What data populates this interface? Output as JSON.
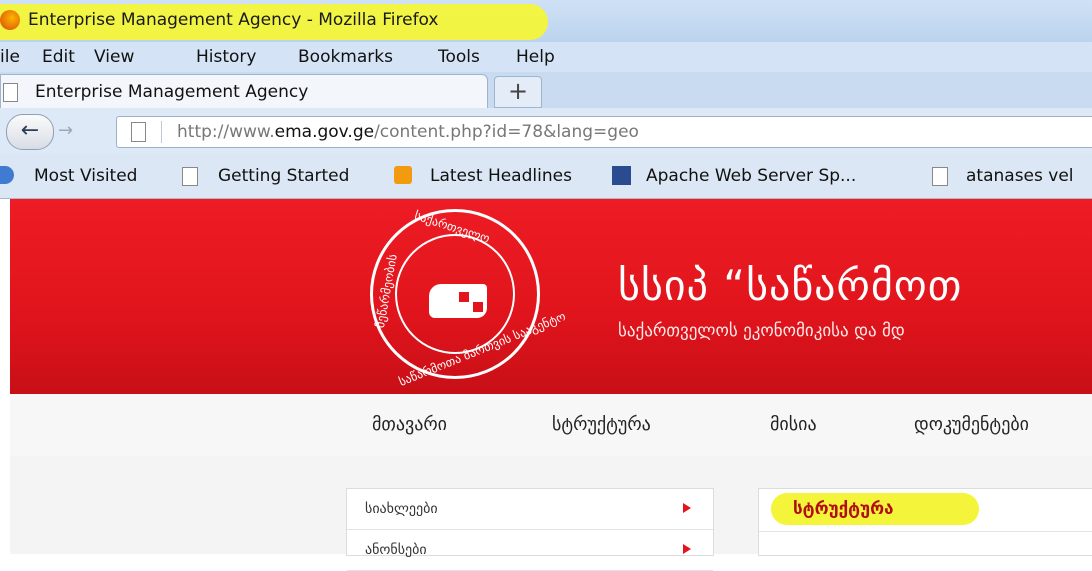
{
  "window": {
    "title": "Enterprise Management Agency - Mozilla Firefox"
  },
  "menu": {
    "file": "ile",
    "edit": "Edit",
    "view": "View",
    "history": "History",
    "bookmarks": "Bookmarks",
    "tools": "Tools",
    "help": "Help"
  },
  "tab": {
    "label": "Enterprise Management Agency",
    "new_tab": "+"
  },
  "nav": {
    "back": "←",
    "forward": "→",
    "url_prefix": "http://www.",
    "url_host": "ema.gov.ge",
    "url_path": "/content.php?id=78&lang=geo"
  },
  "bookmarks": {
    "most_visited": "Most Visited",
    "getting_started": "Getting Started",
    "latest_headlines": "Latest Headlines",
    "apache": "Apache Web Server Sp...",
    "atanases": "atanases vel"
  },
  "site": {
    "seal_top": "საქართველო",
    "seal_left": "მეწარმეობის",
    "seal_bottom": "საწარმოთა მართვის სააგენტო",
    "title": "სსიპ “საწარმოთ",
    "subtitle": "საქართველოს ეკონომიკისა და მდ",
    "nav": [
      "მთავარი",
      "სტრუქტურა",
      "მისია",
      "დოკუმენტები"
    ],
    "sidebar": [
      "სიახლეები",
      "ანონსები"
    ],
    "content_heading": "სტრუქტურა"
  },
  "colors": {
    "brand_red": "#e4141c",
    "highlight": "#f4f53a"
  }
}
